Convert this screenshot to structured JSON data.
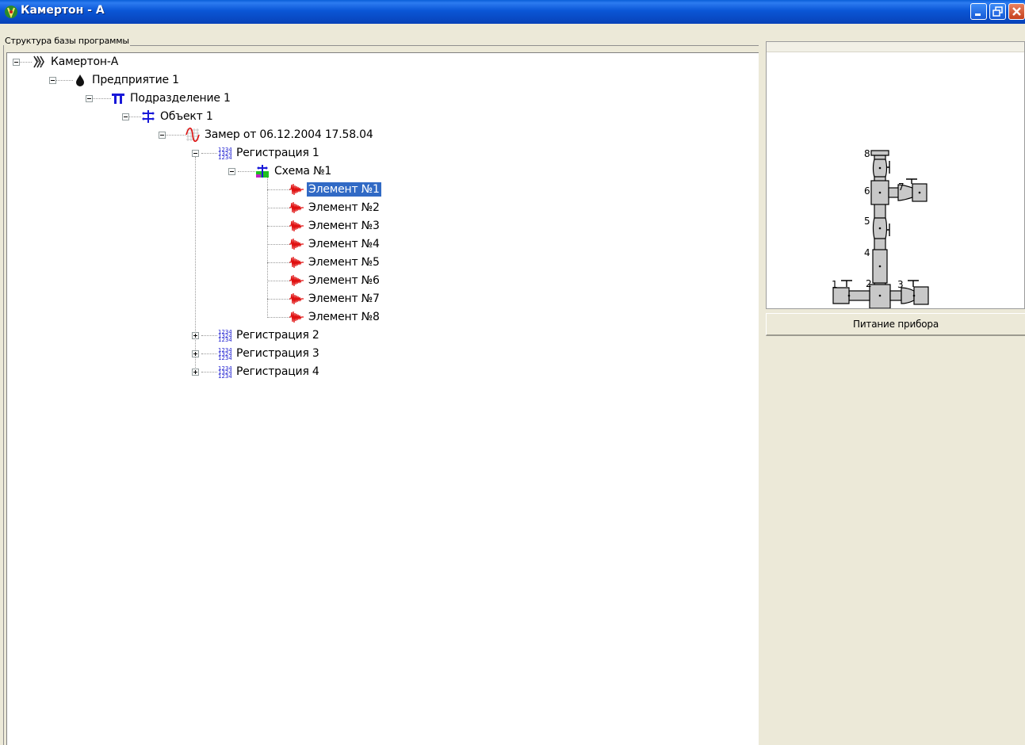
{
  "window": {
    "title": "Камертон - A",
    "buttons": {
      "minimize": "minimize",
      "restore": "restore",
      "close": "close"
    }
  },
  "tree_panel": {
    "group_label": "Структура базы программы",
    "items": [
      {
        "label": "Камертон-А",
        "icon": "tuning-fork-icon"
      },
      {
        "label": "Предприятие 1",
        "icon": "oil-drop-icon"
      },
      {
        "label": "Подразделение 1",
        "icon": "division-icon"
      },
      {
        "label": "Объект 1",
        "icon": "object-icon"
      },
      {
        "label": "Замер от 06.12.2004 17.58.04",
        "icon": "measurement-icon"
      },
      {
        "label": "Регистрация 1",
        "icon": "registration-icon"
      },
      {
        "label": "Схема №1",
        "icon": "scheme-icon"
      },
      {
        "label": "Элемент №1",
        "icon": "signal-icon",
        "selected": true
      },
      {
        "label": "Элемент №2",
        "icon": "signal-icon"
      },
      {
        "label": "Элемент №3",
        "icon": "signal-icon"
      },
      {
        "label": "Элемент №4",
        "icon": "signal-icon"
      },
      {
        "label": "Элемент №5",
        "icon": "signal-icon"
      },
      {
        "label": "Элемент №6",
        "icon": "signal-icon"
      },
      {
        "label": "Элемент №7",
        "icon": "signal-icon"
      },
      {
        "label": "Элемент №8",
        "icon": "signal-icon"
      },
      {
        "label": "Регистрация 2",
        "icon": "registration-icon"
      },
      {
        "label": "Регистрация 3",
        "icon": "registration-icon"
      },
      {
        "label": "Регистрация 4",
        "icon": "registration-icon"
      }
    ]
  },
  "preview": {
    "labels": [
      "8",
      "6",
      "7",
      "5",
      "4",
      "1",
      "2",
      "3"
    ]
  },
  "status": {
    "button_label": "Питание прибора"
  },
  "colors": {
    "titlebar": "#0A56D6",
    "selection": "#316AC5",
    "signal": "#E01010",
    "registration": "#1A1AD0"
  }
}
